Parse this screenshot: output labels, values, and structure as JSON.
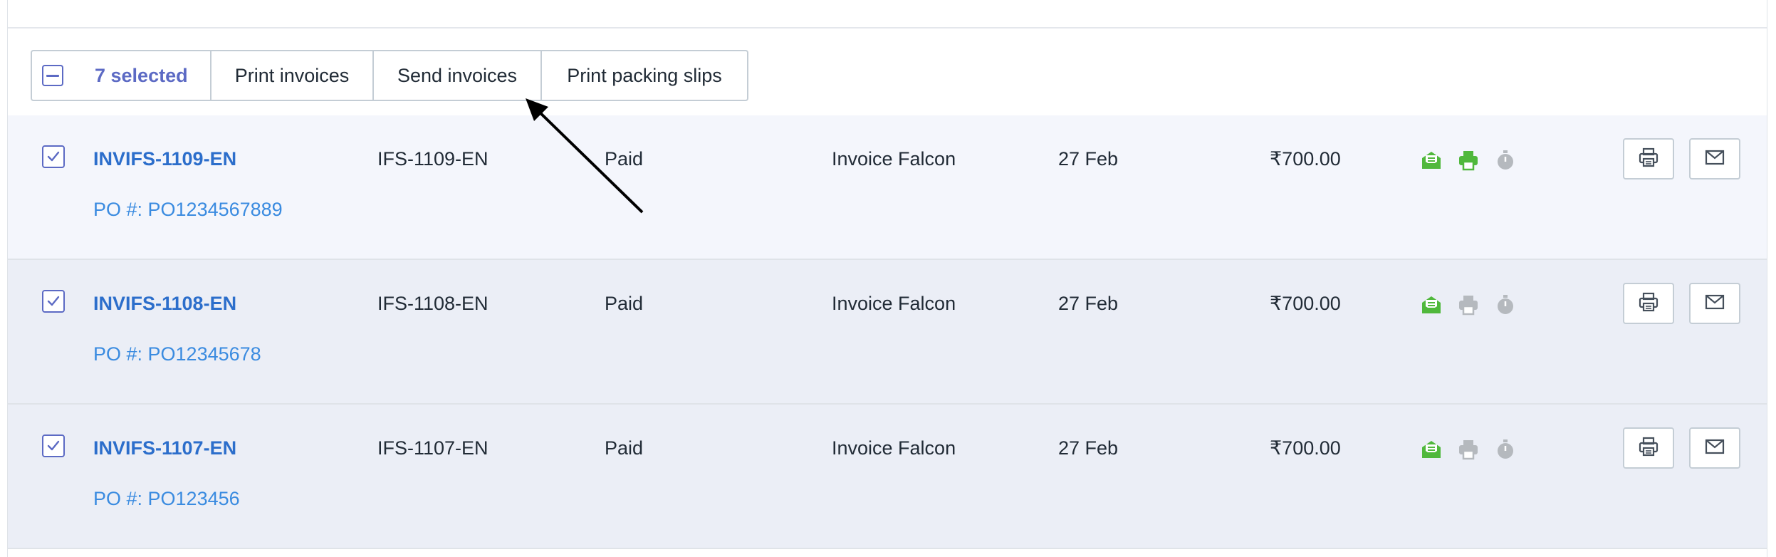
{
  "bulk_actions": {
    "selected_label": "7 selected",
    "print_invoices": "Print invoices",
    "send_invoices": "Send invoices",
    "print_packing_slips": "Print packing slips"
  },
  "invoices": [
    {
      "number": "INVIFS-1109-EN",
      "po": "PO #: PO1234567889",
      "reference": "IFS-1109-EN",
      "status": "Paid",
      "customer": "Invoice Falcon",
      "date": "27 Feb",
      "amount": "₹700.00",
      "sent": true,
      "printed": true,
      "scheduled": false
    },
    {
      "number": "INVIFS-1108-EN",
      "po": "PO #: PO12345678",
      "reference": "IFS-1108-EN",
      "status": "Paid",
      "customer": "Invoice Falcon",
      "date": "27 Feb",
      "amount": "₹700.00",
      "sent": true,
      "printed": false,
      "scheduled": false
    },
    {
      "number": "INVIFS-1107-EN",
      "po": "PO #: PO123456",
      "reference": "IFS-1107-EN",
      "status": "Paid",
      "customer": "Invoice Falcon",
      "date": "27 Feb",
      "amount": "₹700.00",
      "sent": true,
      "printed": false,
      "scheduled": false
    }
  ],
  "icons": {
    "sent": "envelope-open-icon",
    "printed": "printer-icon",
    "scheduled": "stopwatch-icon",
    "row_print": "printer-icon",
    "row_mail": "mail-icon"
  },
  "colors": {
    "accent": "#5c6ac4",
    "link": "#2c6ecb",
    "status_active": "#50b83c",
    "status_inactive": "#b5b9be"
  }
}
